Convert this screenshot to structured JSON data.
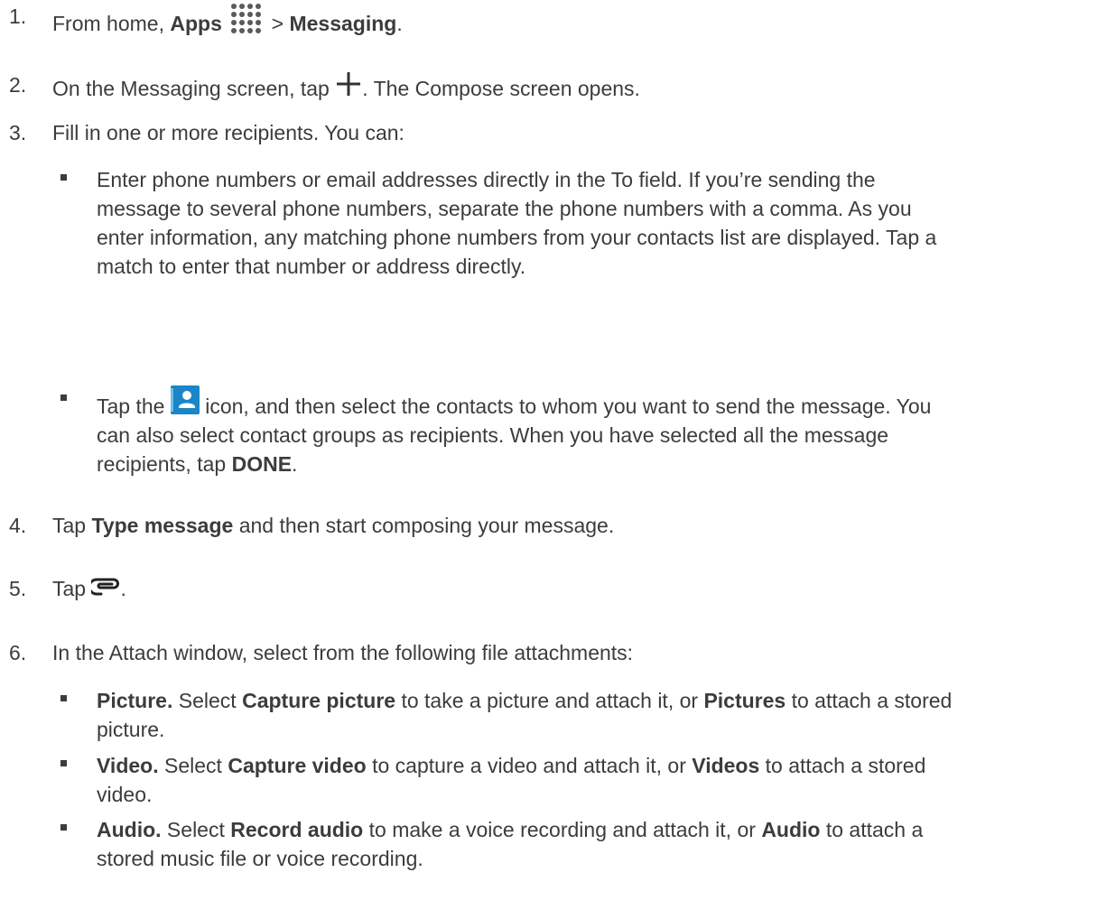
{
  "steps": [
    {
      "num": "1.",
      "pre": "From home, ",
      "b1": "Apps",
      "mid": " > ",
      "b2": "Messaging",
      "end": ".",
      "icon": "apps-grid-icon"
    },
    {
      "num": "2.",
      "pre": "On the Messaging screen, tap ",
      "post": ". The Compose screen opens.",
      "icon": "plus-icon"
    },
    {
      "num": "3.",
      "text": "Fill in one or more recipients. You can:"
    },
    {
      "num": "4.",
      "pre": "Tap ",
      "b1": "Type message",
      "post": " and then start composing your message."
    },
    {
      "num": "5.",
      "pre": "Tap ",
      "post": ".",
      "icon": "paperclip-icon"
    },
    {
      "num": "6.",
      "text": "In the Attach window, select from the following file attachments:"
    }
  ],
  "recipient_options": {
    "enter_numbers": [
      "Enter phone numbers or email addresses directly in the To field. If you’re sending the",
      "message to several phone numbers, separate the phone numbers with a comma. As you",
      "enter information, any matching phone numbers from your contacts list are displayed. Tap a",
      "match to enter that number or address directly."
    ],
    "contacts": {
      "l1_pre": "Tap the ",
      "l1_post": " icon, and then select the contacts to whom you want to send the message. You",
      "l2": "can also select contact groups as recipients. When you have selected all the message",
      "l3_pre": "recipients, tap ",
      "l3_bold": "DONE",
      "l3_post": ".",
      "icon": "contacts-icon"
    }
  },
  "attachments": [
    {
      "label": "Picture.",
      "t1": " Select ",
      "b1": "Capture picture",
      "t2": " to take a picture and attach it, or ",
      "b2": "Pictures",
      "t3": " to attach a stored",
      "cont": "picture."
    },
    {
      "label": "Video.",
      "t1": " Select ",
      "b1": "Capture video",
      "t2": " to capture a video and attach it, or ",
      "b2": "Videos",
      "t3": " to attach a stored",
      "cont": "video."
    },
    {
      "label": "Audio.",
      "t1": " Select ",
      "b1": "Record audio",
      "t2": " to make a voice recording and attach it, or ",
      "b2": "Audio",
      "t3": " to attach a",
      "cont": "stored music file or voice recording."
    }
  ],
  "colors": {
    "text": "#3c3c3c",
    "contact_icon_bg": "#1a86c8",
    "icon": "#4a4a4a"
  }
}
